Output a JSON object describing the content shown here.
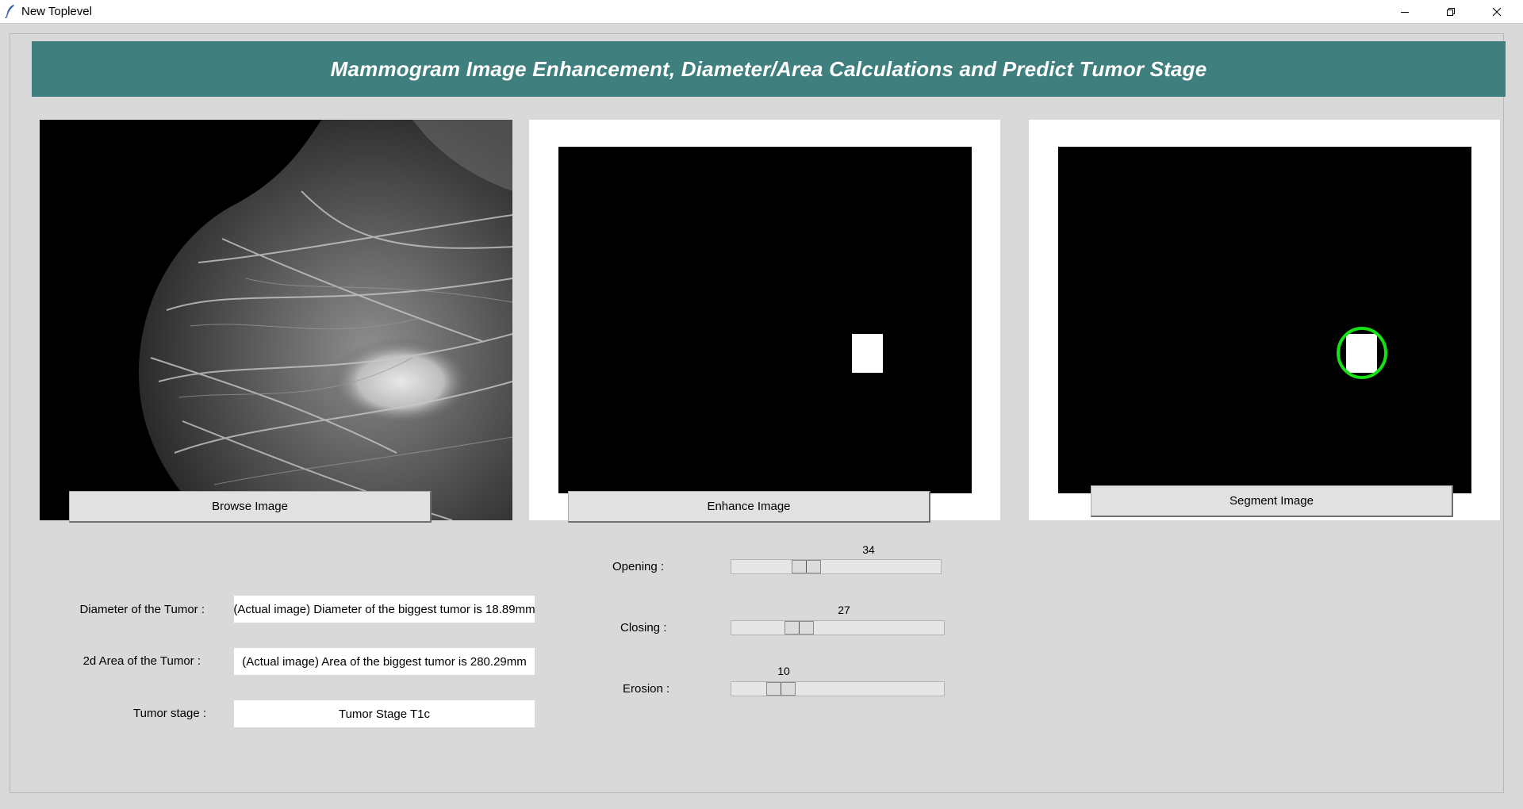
{
  "window": {
    "title": "New Toplevel",
    "minimize_icon": "minimize-icon",
    "restore_icon": "restore-icon",
    "close_icon": "close-icon"
  },
  "header": {
    "title": "Mammogram Image Enhancement, Diameter/Area Calculations and Predict Tumor Stage",
    "background_color": "#3f7f7e"
  },
  "panels": {
    "original": {
      "button_label": "Browse Image"
    },
    "enhanced": {
      "button_label": "Enhance Image"
    },
    "segmented": {
      "button_label": "Segment Image",
      "marker_color": "#16e016"
    }
  },
  "results": {
    "diameter": {
      "label": "Diameter of the Tumor :",
      "value": "(Actual image) Diameter of the biggest tumor is 18.89mm"
    },
    "area": {
      "label": "2d Area of the Tumor :",
      "value": "(Actual image) Area of the biggest tumor is 280.29mm"
    },
    "stage": {
      "label": "Tumor stage :",
      "value": "Tumor Stage T1c"
    }
  },
  "sliders": {
    "opening": {
      "label": "Opening :",
      "value": "34",
      "min": 0,
      "max": 100
    },
    "closing": {
      "label": "Closing :",
      "value": "27",
      "min": 0,
      "max": 100
    },
    "erosion": {
      "label": "Erosion :",
      "value": "10",
      "min": 0,
      "max": 100
    }
  }
}
